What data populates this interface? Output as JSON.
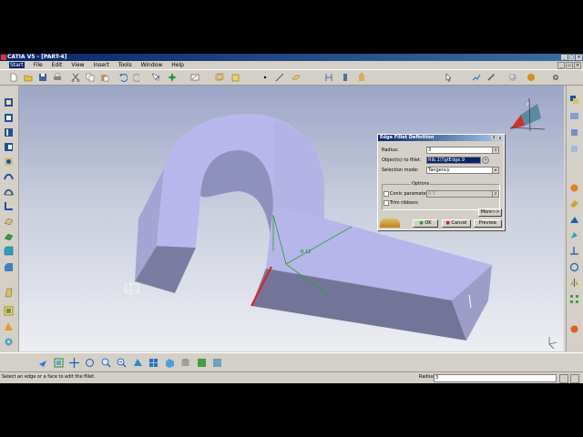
{
  "window": {
    "title": "CATIA V5 - [PART-4]",
    "menu": [
      "Start",
      "File",
      "Edit",
      "View",
      "Insert",
      "Tools",
      "Window",
      "Help"
    ]
  },
  "dialog": {
    "title": "Edge Fillet Definition",
    "radius_label": "Radius:",
    "radius_value": "3",
    "objects_label": "Object(s) to fillet:",
    "objects_value": "Rib.1\\TgtEdge.9",
    "selection_mode_label": "Selection mode:",
    "selection_mode_value": "Tangency",
    "options_label": "Options",
    "conic_label": "Conic parameter:",
    "conic_value": "0.5",
    "trim_label": "Trim ribbons",
    "more_button": "More>>",
    "ok_button": "OK",
    "cancel_button": "Cancel",
    "preview_button": "Preview"
  },
  "viewport": {
    "edge_label": "R 12"
  },
  "status": {
    "message": "Select an edge or a face to edit the fillet.",
    "param_label": "Radius",
    "param_value": "3"
  },
  "colors": {
    "part_face": "#b8b8ec",
    "part_side": "#a9a9d8",
    "part_dark": "#727598",
    "selected_edge": "#e02020",
    "axis_green": "#2aa02a",
    "titlebar": "#0a246a"
  }
}
